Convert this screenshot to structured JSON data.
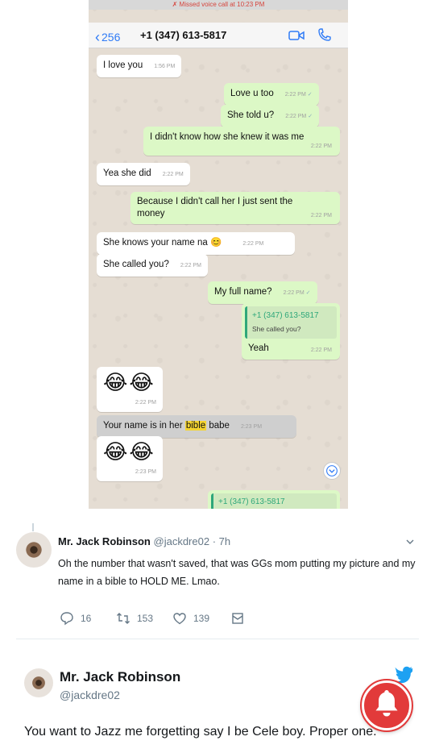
{
  "chat": {
    "missed_call": "Missed voice call at 10:23 PM",
    "back_count": "256",
    "contact": "+1 (347) 613-5817",
    "messages": [
      {
        "text": "I love you",
        "time": "1:56 PM"
      },
      {
        "text": "Love u too",
        "time": "2:22 PM"
      },
      {
        "text": "She told u?",
        "time": "2:22 PM"
      },
      {
        "text": "I didn't know how she knew it was me",
        "time": "2:22 PM"
      },
      {
        "text": "Yea she did",
        "time": "2:22 PM"
      },
      {
        "text_line1": "Because I didn't call her I just sent the",
        "text_line2": "money",
        "time": "2:22 PM"
      },
      {
        "text": "She knows your name na",
        "emoji": "😊",
        "time": "2:22 PM"
      },
      {
        "text": "She called you?",
        "time": "2:22 PM"
      },
      {
        "text": "My full name?",
        "time": "2:22 PM"
      },
      {
        "quote_name": "+1 (347) 613-5817",
        "quote_text": "She called you?",
        "text": "Yeah",
        "time": "2:22 PM"
      },
      {
        "emoji": "😂😂",
        "time": "2:22 PM"
      },
      {
        "text_before": "Your name is in her ",
        "highlight": "bible",
        "text_after": " babe",
        "time": "2:23 PM"
      },
      {
        "emoji": "😂😂",
        "time": "2:23 PM"
      },
      {
        "quote_name": "+1 (347) 613-5817"
      }
    ]
  },
  "tweet1": {
    "name": "Mr. Jack Robinson",
    "handle": "@jackdre02",
    "age": "· 7h",
    "text_line1": "Oh the number that wasn't saved, that was GGs mom putting my picture and my",
    "text_line2": "name in a bible to HOLD ME. Lmao.",
    "replies": "16",
    "retweets": "153",
    "likes": "139"
  },
  "tweet2": {
    "name": "Mr. Jack Robinson",
    "handle": "@jackdre02",
    "text": "You want to Jazz me forgetting say I be Cele boy. Proper one."
  },
  "colors": {
    "outgoing_bubble": "#dcf8c6",
    "incoming_bubble": "#ffffff",
    "ios_blue": "#2f7bf6",
    "twitter_blue": "#1da1f2",
    "bell_red": "#e23a3a"
  }
}
